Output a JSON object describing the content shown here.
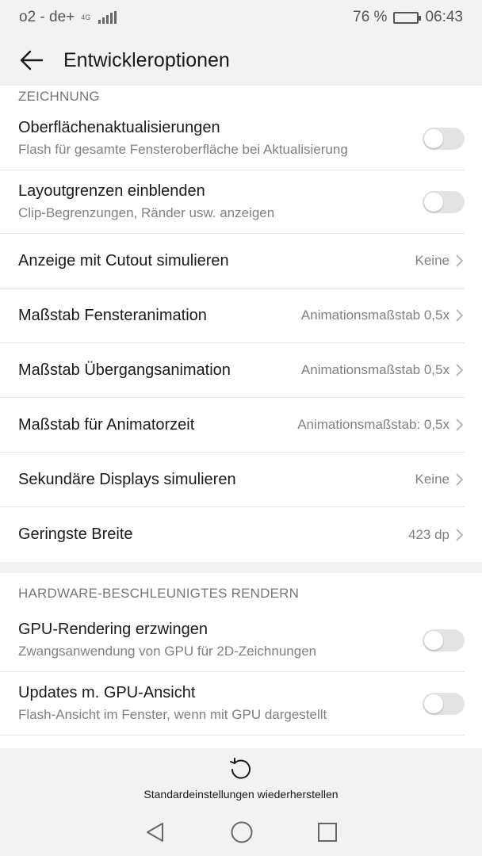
{
  "status_bar": {
    "carrier": "o2 - de+",
    "network_type": "4G",
    "battery_percent": "76 %",
    "battery_level": 0.76,
    "time": "06:43"
  },
  "app_bar": {
    "back_icon": "arrow-back-icon",
    "title": "Entwickleroptionen"
  },
  "sections": {
    "drawing": {
      "header": "ZEICHNUNG",
      "items": [
        {
          "title": "Oberflächenaktualisierungen",
          "subtitle": "Flash für gesamte Fensteroberfläche bei Aktualisierung",
          "toggle_on": false
        },
        {
          "title": "Layoutgrenzen einblenden",
          "subtitle": "Clip-Begrenzungen, Ränder usw. anzeigen",
          "toggle_on": false
        },
        {
          "title": "Anzeige mit Cutout simulieren",
          "value": "Keine"
        },
        {
          "title": "Maßstab Fensteranimation",
          "value": "Animationsmaßstab 0,5x"
        },
        {
          "title": "Maßstab Übergangsanimation",
          "value": "Animationsmaßstab 0,5x"
        },
        {
          "title": "Maßstab für Animatorzeit",
          "value": "Animationsmaßstab: 0,5x"
        },
        {
          "title": "Sekundäre Displays simulieren",
          "value": "Keine"
        },
        {
          "title": "Geringste Breite",
          "value": "423 dp"
        }
      ]
    },
    "hardware": {
      "header": "HARDWARE-BESCHLEUNIGTES RENDERN",
      "items": [
        {
          "title": "GPU-Rendering erzwingen",
          "subtitle": "Zwangsanwendung von GPU für 2D-Zeichnungen",
          "toggle_on": false
        },
        {
          "title": "Updates m. GPU-Ansicht",
          "subtitle": "Flash-Ansicht im Fenster, wenn mit GPU dargestellt",
          "toggle_on": false
        }
      ]
    }
  },
  "restore": {
    "icon": "restore-icon",
    "label": "Standardeinstellungen wiederherstellen"
  },
  "nav_bar": {
    "back_icon": "nav-back-icon",
    "home_icon": "nav-home-icon",
    "recents_icon": "nav-recents-icon"
  },
  "colors": {
    "bar_background": "#f2f2f2",
    "toggle_off": "#e3e3e3",
    "secondary_text": "#808080"
  }
}
